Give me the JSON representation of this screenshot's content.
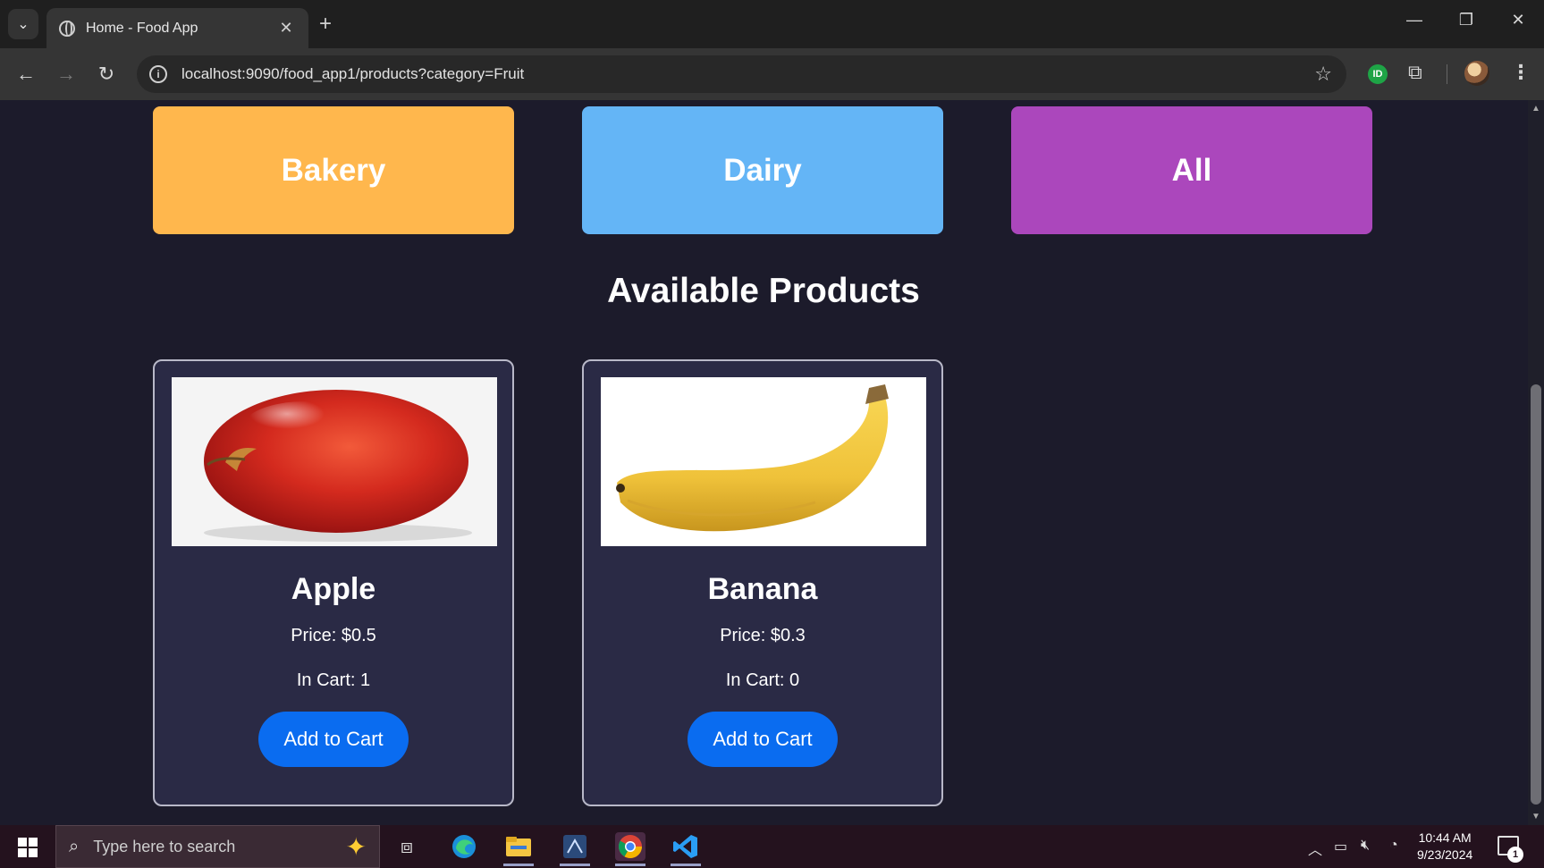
{
  "browser": {
    "tab_title": "Home - Food App",
    "url": "localhost:9090/food_app1/products?category=Fruit"
  },
  "categories": [
    {
      "label": "Bakery",
      "color": "#ffb74d"
    },
    {
      "label": "Dairy",
      "color": "#64b5f6"
    },
    {
      "label": "All",
      "color": "#ab47bc"
    }
  ],
  "heading": "Available Products",
  "products": [
    {
      "name": "Apple",
      "price": "Price: $0.5",
      "in_cart": "In Cart: 1",
      "button": "Add to Cart"
    },
    {
      "name": "Banana",
      "price": "Price: $0.3",
      "in_cart": "In Cart: 0",
      "button": "Add to Cart"
    }
  ],
  "colors": {
    "page_background": "#1c1b2b",
    "card_background": "#2a2a45",
    "button": "#0a6cf0"
  },
  "taskbar": {
    "search_placeholder": "Type here to search",
    "time": "10:44 AM",
    "date": "9/23/2024",
    "notification_count": "1"
  }
}
